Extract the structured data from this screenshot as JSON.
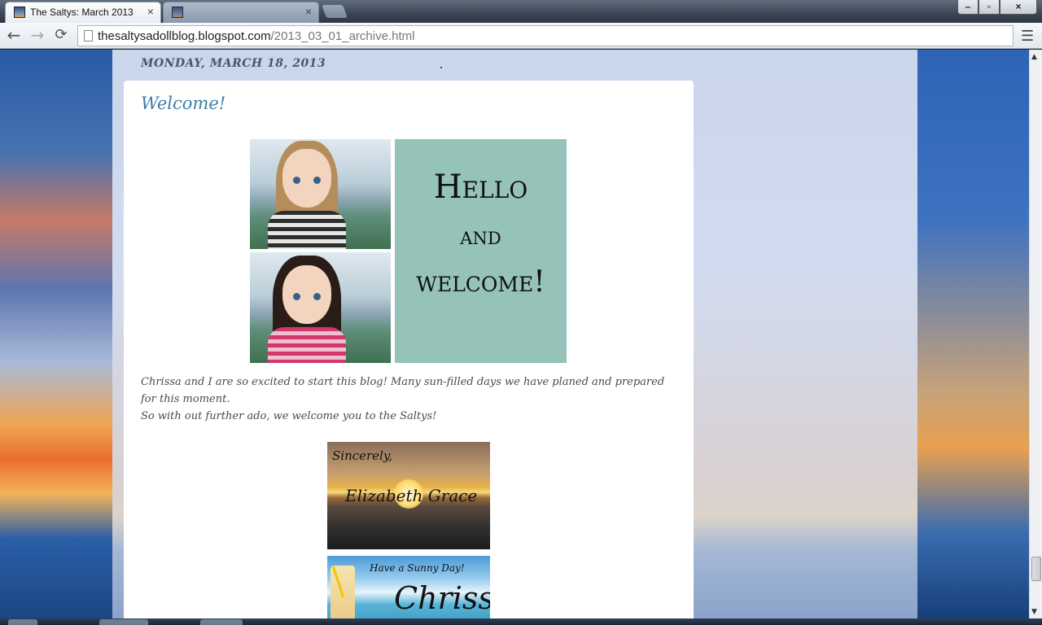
{
  "browser": {
    "tabs": [
      {
        "title": "The Saltys: March 2013",
        "active": true
      },
      {
        "title": "",
        "active": false
      }
    ],
    "url_host": "thesaltysadollblog.blogspot.com",
    "url_path": "/2013_03_01_archive.html",
    "icons": {
      "back": "←",
      "forward": "→",
      "reload": "⟳",
      "star": "★",
      "menu": "☰",
      "close": "×",
      "minimize": "–",
      "maximize": "▫"
    }
  },
  "blog": {
    "date_header": "MONDAY, MARCH 18, 2013",
    "post": {
      "title": "Welcome!",
      "collage": {
        "line1": "Hello",
        "line2": "and",
        "line3": "welcome!"
      },
      "body_line1": "Chrissa and I are so excited to start this blog!  Many sun-filled days we have planed and prepared for this moment.",
      "body_line2": "So with out further ado, we welcome you to the Saltys!",
      "signature1": {
        "greeting": "Sincerely,",
        "name": "Elizabeth Grace"
      },
      "signature2": {
        "tagline": "Have a Sunny Day!",
        "name": "Chrissa"
      }
    }
  },
  "colors": {
    "title_blue": "#3b7ea7",
    "collage_teal": "#95c2b9",
    "star_gold": "#e7b800"
  }
}
